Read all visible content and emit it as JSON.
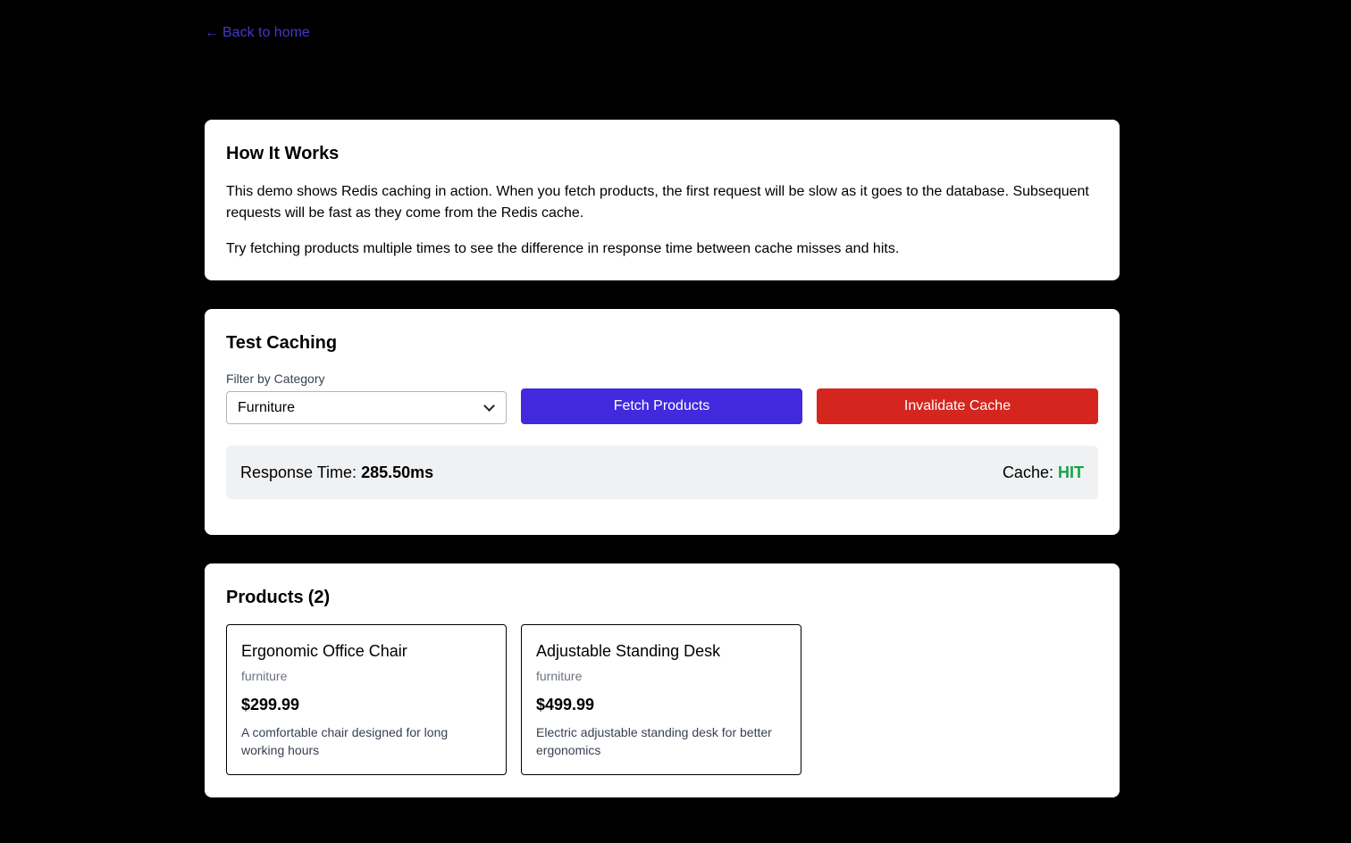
{
  "nav": {
    "back_arrow": "←",
    "back_label": "Back to home"
  },
  "how_it_works": {
    "title": "How It Works",
    "paragraph1": "This demo shows Redis caching in action. When you fetch products, the first request will be slow as it goes to the database. Subsequent requests will be fast as they come from the Redis cache.",
    "paragraph2": "Try fetching products multiple times to see the difference in response time between cache misses and hits."
  },
  "test_caching": {
    "title": "Test Caching",
    "filter_label": "Filter by Category",
    "selected_category": "Furniture",
    "fetch_button": "Fetch Products",
    "invalidate_button": "Invalidate Cache",
    "response_time_label": "Response Time:",
    "response_time_value": "285.50ms",
    "cache_label": "Cache:",
    "cache_status": "HIT"
  },
  "products": {
    "title": "Products",
    "count": "(2)",
    "items": [
      {
        "name": "Ergonomic Office Chair",
        "category": "furniture",
        "price": "$299.99",
        "description": "A comfortable chair designed for long working hours"
      },
      {
        "name": "Adjustable Standing Desk",
        "category": "furniture",
        "price": "$499.99",
        "description": "Electric adjustable standing desk for better ergonomics"
      }
    ]
  },
  "colors": {
    "background": "#000000",
    "link": "#4338ca",
    "fetch_button": "#4229dd",
    "invalidate_button": "#d4261f",
    "cache_hit": "#16a34a"
  }
}
